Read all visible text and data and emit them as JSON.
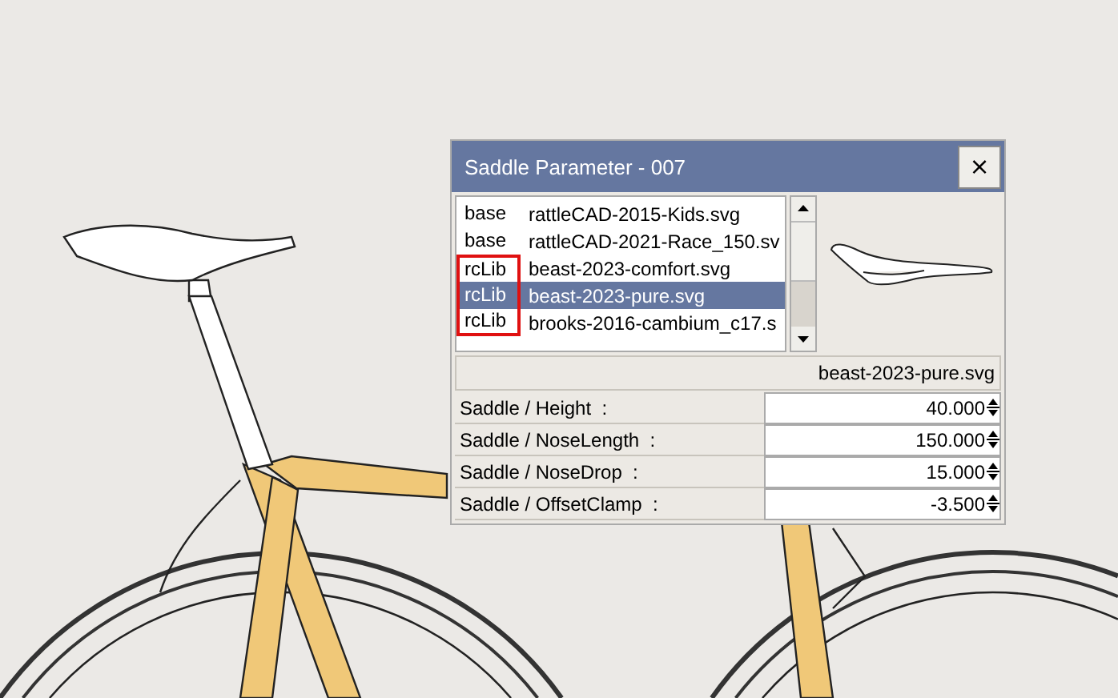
{
  "window": {
    "title": "Saddle Parameter - 007",
    "close_label": "×"
  },
  "file_list": {
    "rows": [
      {
        "source": "base",
        "file": "rattleCAD-2015-Kids.svg",
        "selected": false,
        "marked": false
      },
      {
        "source": "base",
        "file": "rattleCAD-2021-Race_150.sv",
        "selected": false,
        "marked": false
      },
      {
        "source": "rcLib",
        "file": "beast-2023-comfort.svg",
        "selected": false,
        "marked": true
      },
      {
        "source": "rcLib",
        "file": "beast-2023-pure.svg",
        "selected": true,
        "marked": true
      },
      {
        "source": "rcLib",
        "file": "brooks-2016-cambium_c17.s",
        "selected": false,
        "marked": true
      }
    ]
  },
  "current_file": "beast-2023-pure.svg",
  "parameters": [
    {
      "label": "Saddle / Height  :",
      "value": "40.000"
    },
    {
      "label": "Saddle / NoseLength  :",
      "value": "150.000"
    },
    {
      "label": "Saddle / NoseDrop  :",
      "value": "15.000"
    },
    {
      "label": "Saddle / OffsetClamp  :",
      "value": "-3.500"
    }
  ]
}
